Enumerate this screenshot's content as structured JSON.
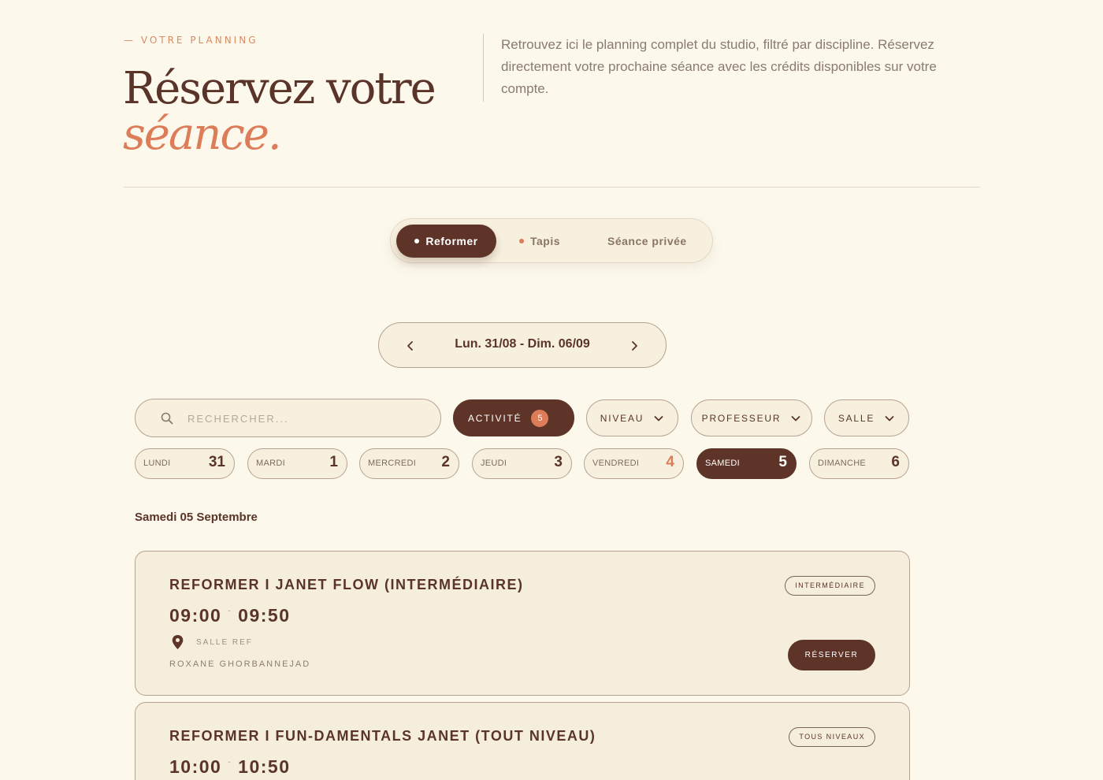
{
  "header": {
    "eyebrow": "— VOTRE PLANNING",
    "title_line1": "Réservez votre",
    "title_line2": "séance.",
    "intro": "Retrouvez ici le planning complet du studio, filtré par discipline. Réservez directement votre prochaine séance avec les crédits disponibles sur votre compte."
  },
  "disciplines": {
    "items": [
      {
        "label": "Reformer",
        "active": true
      },
      {
        "label": "Tapis"
      },
      {
        "label": "Séance privée"
      }
    ]
  },
  "week": {
    "range": "Lun. 31/08 - Dim. 06/09",
    "prev_icon": "chevron-left-icon",
    "next_icon": "chevron-right-icon"
  },
  "filters": {
    "search_placeholder": "RECHERCHER...",
    "activity_label": "ACTIVITÉ",
    "activity_count": "5",
    "level_label": "NIVEAU",
    "teacher_label": "PROFESSEUR",
    "room_label": "SALLE"
  },
  "days": [
    {
      "name": "LUNDI",
      "num": "31"
    },
    {
      "name": "MARDI",
      "num": "1"
    },
    {
      "name": "MERCREDI",
      "num": "2"
    },
    {
      "name": "JEUDI",
      "num": "3"
    },
    {
      "name": "VENDREDI",
      "num": "4",
      "state": "today"
    },
    {
      "name": "SAMEDI",
      "num": "5",
      "state": "selected"
    },
    {
      "name": "DIMANCHE",
      "num": "6"
    }
  ],
  "date_heading": "Samedi 05 Septembre",
  "sessions": [
    {
      "title": "REFORMER I JANET FLOW (INTERMÉDIAIRE)",
      "start": "09:00",
      "sep": "-",
      "end": "09:50",
      "level": "INTERMÉDIAIRE",
      "room": "SALLE REF",
      "teacher": "ROXANE GHORBANNEJAD",
      "cta": "RÉSERVER"
    },
    {
      "title": "REFORMER I FUN-DAMENTALS JANET (TOUT NIVEAU)",
      "start": "10:00",
      "sep": "-",
      "end": "10:50",
      "level": "TOUS NIVEAUX"
    }
  ],
  "colors": {
    "background": "#fcf8ec",
    "primary_dark": "#5e3429",
    "accent": "#dd7c58",
    "border": "#b7a291"
  }
}
